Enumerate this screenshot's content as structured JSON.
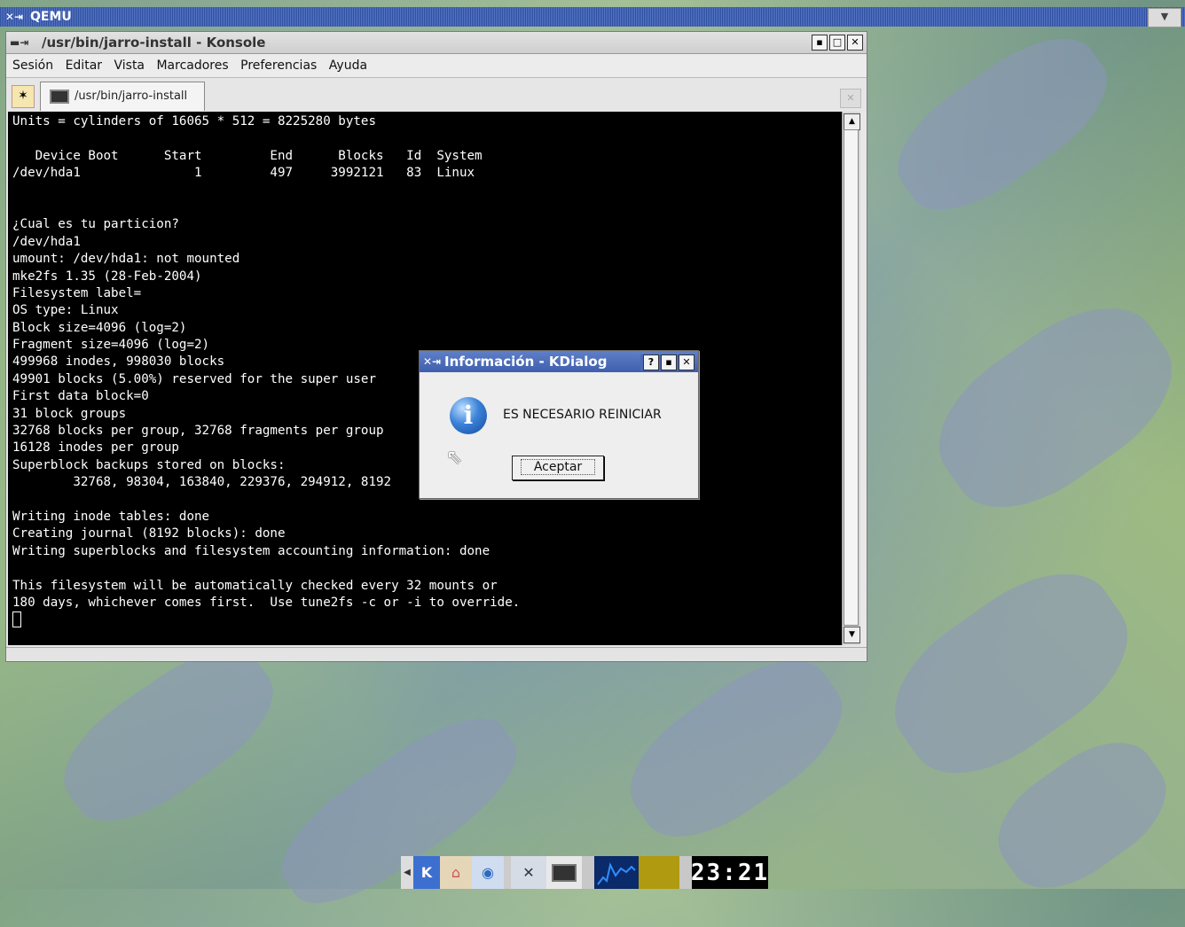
{
  "qemu": {
    "title": "QEMU",
    "app_icon": "x-icon",
    "menu_button": "▼"
  },
  "konsole": {
    "title": "/usr/bin/jarro-install - Konsole",
    "menu": [
      "Sesión",
      "Editar",
      "Vista",
      "Marcadores",
      "Preferencias",
      "Ayuda"
    ],
    "tab_label": "/usr/bin/jarro-install",
    "window_buttons": [
      "▪",
      "□",
      "✕"
    ],
    "terminal_lines": [
      "Units = cylinders of 16065 * 512 = 8225280 bytes",
      "",
      "   Device Boot      Start         End      Blocks   Id  System",
      "/dev/hda1               1         497     3992121   83  Linux",
      "",
      "",
      "¿Cual es tu particion?",
      "/dev/hda1",
      "umount: /dev/hda1: not mounted",
      "mke2fs 1.35 (28-Feb-2004)",
      "Filesystem label=",
      "OS type: Linux",
      "Block size=4096 (log=2)",
      "Fragment size=4096 (log=2)",
      "499968 inodes, 998030 blocks",
      "49901 blocks (5.00%) reserved for the super user",
      "First data block=0",
      "31 block groups",
      "32768 blocks per group, 32768 fragments per group",
      "16128 inodes per group",
      "Superblock backups stored on blocks:",
      "        32768, 98304, 163840, 229376, 294912, 8192",
      "",
      "Writing inode tables: done",
      "Creating journal (8192 blocks): done",
      "Writing superblocks and filesystem accounting information: done",
      "",
      "This filesystem will be automatically checked every 32 mounts or",
      "180 days, whichever comes first.  Use tune2fs -c or -i to override."
    ]
  },
  "kdialog": {
    "title": "Información - KDialog",
    "message": "ES NECESARIO REINICIAR",
    "accept_button": "Aceptar",
    "window_buttons": [
      "?",
      "▪",
      "✕"
    ]
  },
  "taskbar": {
    "clock": "23:21",
    "items": [
      "kde-menu-icon",
      "home-icon",
      "browser-icon",
      "x-icon",
      "konsole-icon",
      "system-monitor-icon"
    ]
  }
}
